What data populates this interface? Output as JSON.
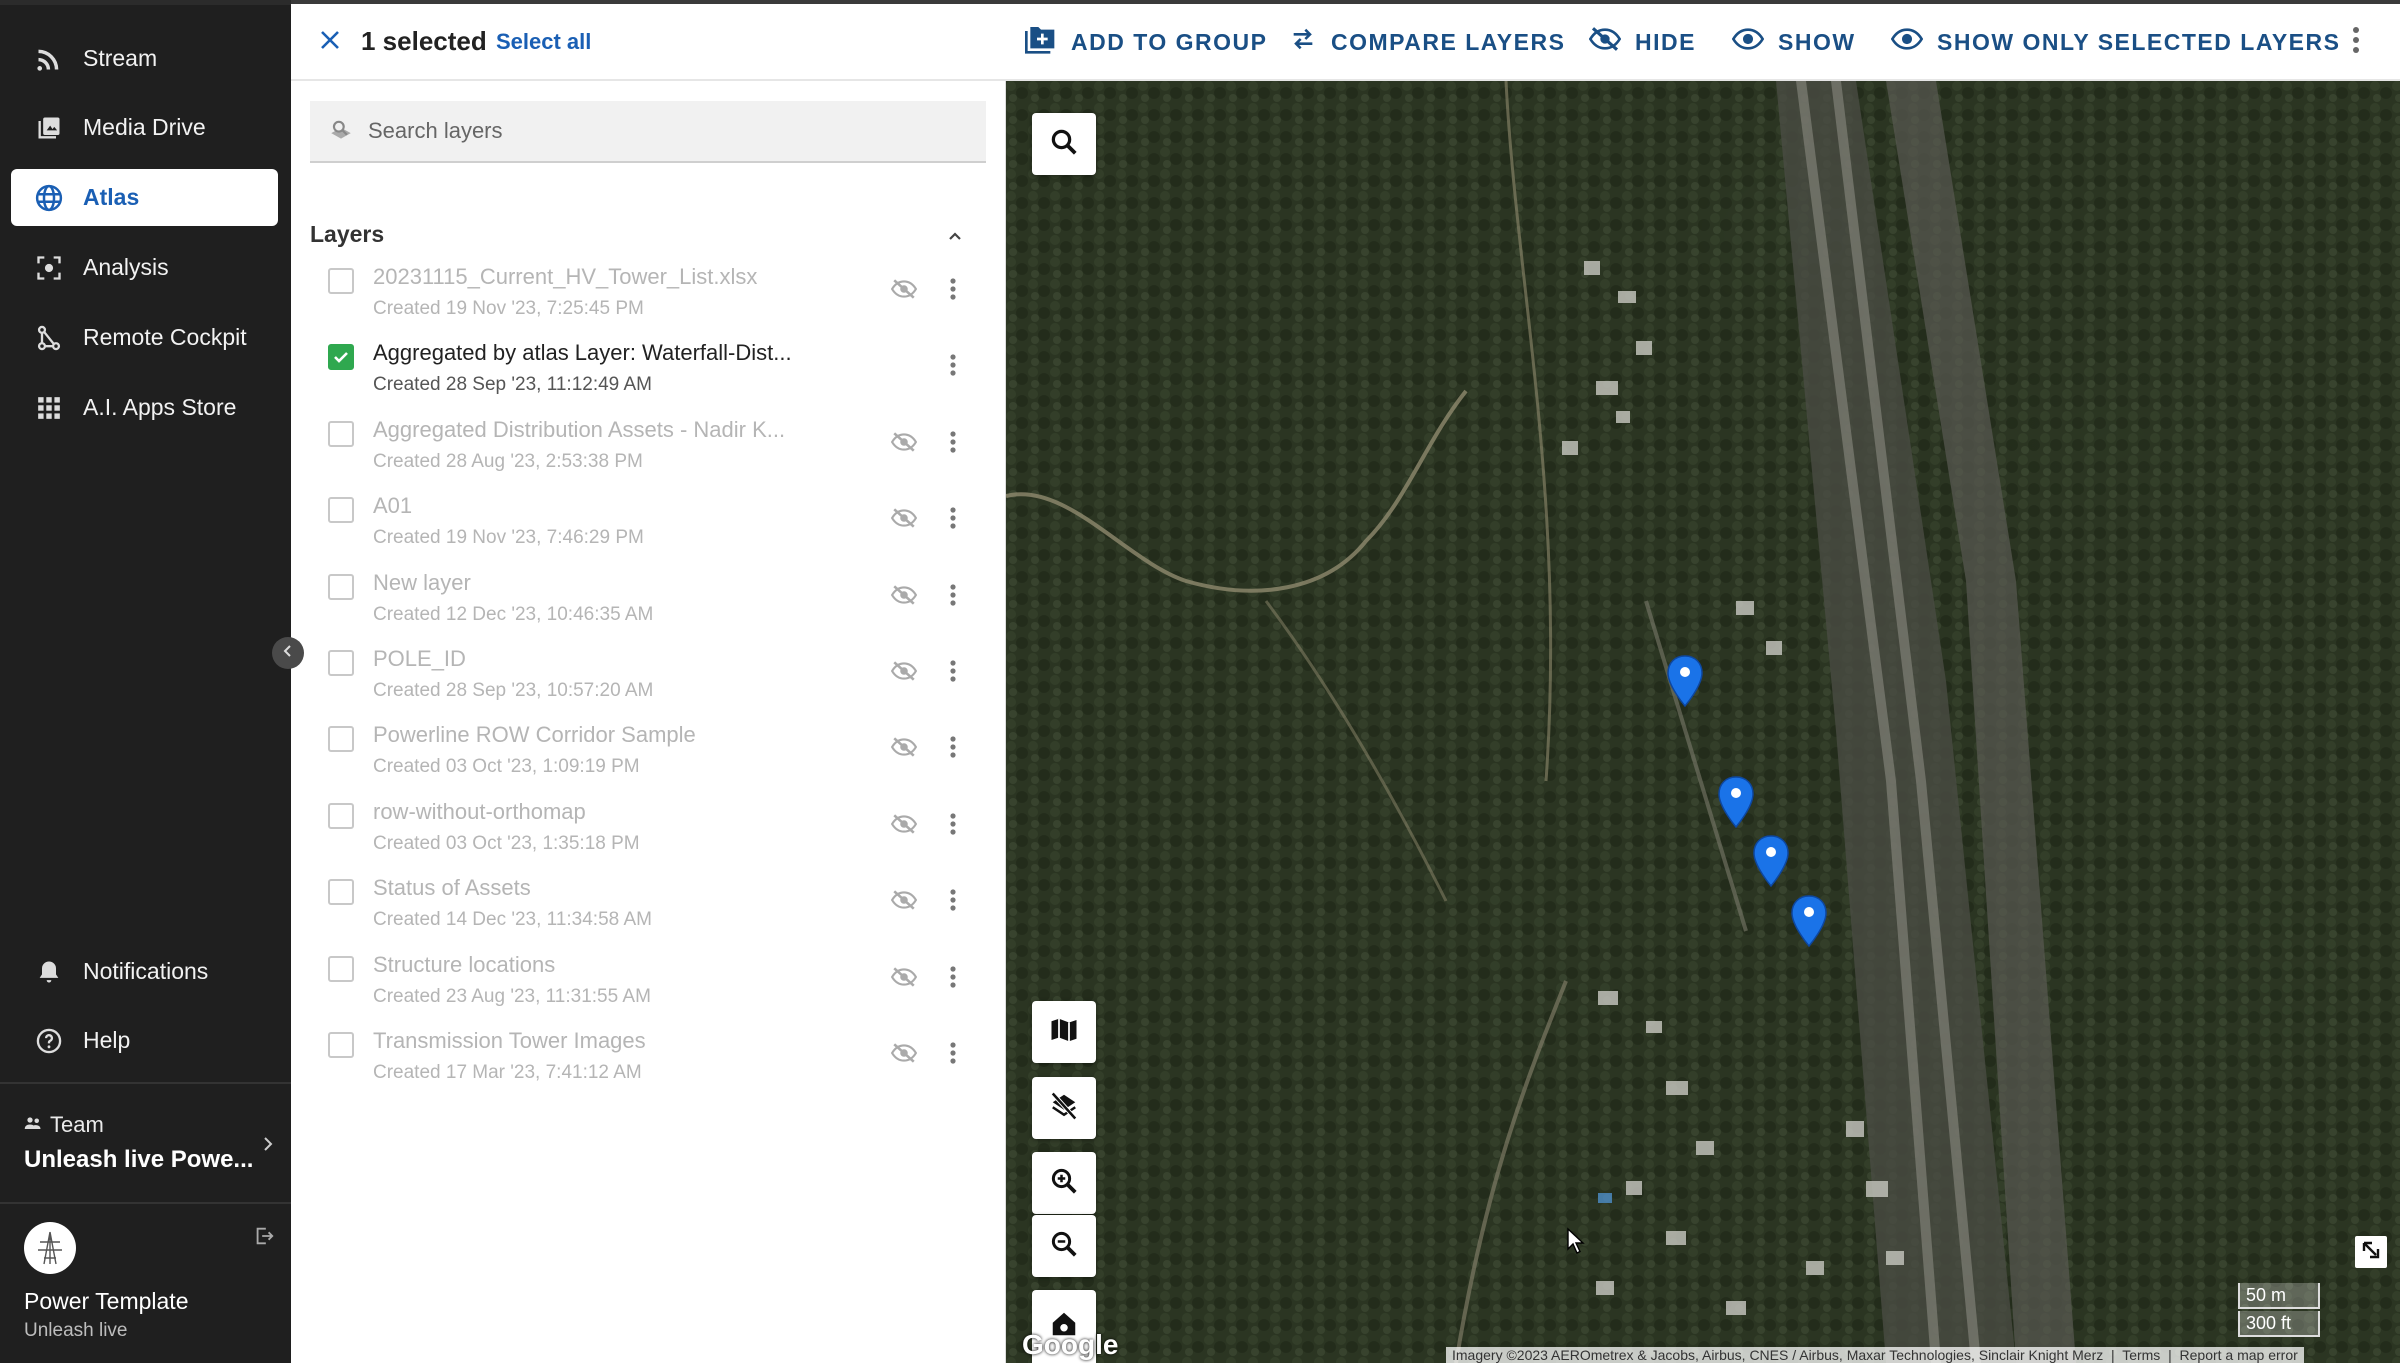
{
  "nav": {
    "items": [
      {
        "label": "Stream",
        "icon": "stream-icon"
      },
      {
        "label": "Media Drive",
        "icon": "media-drive-icon"
      },
      {
        "label": "Atlas",
        "icon": "globe-icon",
        "active": true
      },
      {
        "label": "Analysis",
        "icon": "analysis-icon"
      },
      {
        "label": "Remote Cockpit",
        "icon": "remote-cockpit-icon"
      },
      {
        "label": "A.I. Apps Store",
        "icon": "apps-grid-icon"
      }
    ],
    "notifications": "Notifications",
    "help": "Help",
    "team_label": "Team",
    "team_name": "Unleash live Powe...",
    "user_name": "Power Template",
    "user_sub": "Unleash live"
  },
  "toolbar": {
    "selected_count": "1 selected",
    "select_all": "Select all",
    "add_to_group": "ADD TO GROUP",
    "compare_layers": "COMPARE LAYERS",
    "hide": "HIDE",
    "show": "SHOW",
    "show_only_selected": "SHOW ONLY SELECTED LAYERS"
  },
  "panel": {
    "search_placeholder": "Search layers",
    "layers_heading": "Layers",
    "layers": [
      {
        "name": "20231115_Current_HV_Tower_List.xlsx",
        "created": "Created 19 Nov '23, 7:25:45 PM",
        "checked": false,
        "hidden": true
      },
      {
        "name": "Aggregated by atlas Layer: Waterfall-Dist...",
        "created": "Created 28 Sep '23, 11:12:49 AM",
        "checked": true,
        "hidden": false
      },
      {
        "name": "Aggregated Distribution Assets - Nadir K...",
        "created": "Created 28 Aug '23, 2:53:38 PM",
        "checked": false,
        "hidden": true
      },
      {
        "name": "A01",
        "created": "Created 19 Nov '23, 7:46:29 PM",
        "checked": false,
        "hidden": true
      },
      {
        "name": "New layer",
        "created": "Created 12 Dec '23, 10:46:35 AM",
        "checked": false,
        "hidden": true
      },
      {
        "name": "POLE_ID",
        "created": "Created 28 Sep '23, 10:57:20 AM",
        "checked": false,
        "hidden": true
      },
      {
        "name": "Powerline ROW Corridor Sample",
        "created": "Created 03 Oct '23, 1:09:19 PM",
        "checked": false,
        "hidden": true
      },
      {
        "name": "row-without-orthomap",
        "created": "Created 03 Oct '23, 1:35:18 PM",
        "checked": false,
        "hidden": true
      },
      {
        "name": "Status of Assets",
        "created": "Created 14 Dec '23, 11:34:58 AM",
        "checked": false,
        "hidden": true
      },
      {
        "name": "Structure locations",
        "created": "Created 23 Aug '23, 11:31:55 AM",
        "checked": false,
        "hidden": true
      },
      {
        "name": "Transmission Tower Images",
        "created": "Created 17 Mar '23, 7:41:12 AM",
        "checked": false,
        "hidden": true
      }
    ]
  },
  "map": {
    "scale_m": "50 m",
    "scale_ft": "300 ft",
    "google": "Google",
    "attribution": "Imagery ©2023 AEROmetrex & Jacobs, Airbus, CNES / Airbus, Maxar Technologies, Sinclair Knight Merz",
    "terms": "Terms",
    "report": "Report a map error",
    "marker_color": "#1a73e8"
  },
  "colors": {
    "accent": "#1a5fb4",
    "toolbar_action": "#1a4f85",
    "check": "#2fa84f",
    "nav_bg": "#1f1f1f"
  }
}
